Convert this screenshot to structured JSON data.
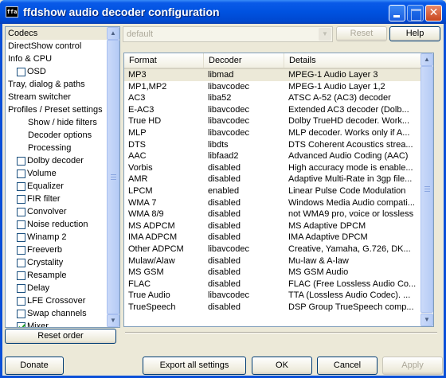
{
  "window": {
    "title": "ffdshow audio decoder configuration",
    "icon_label": "ffa"
  },
  "sidebar": {
    "items": [
      {
        "label": "Codecs",
        "type": "plain",
        "selected": true
      },
      {
        "label": "DirectShow control",
        "type": "plain"
      },
      {
        "label": "Info & CPU",
        "type": "plain"
      },
      {
        "label": "OSD",
        "type": "check",
        "checked": false
      },
      {
        "label": "Tray, dialog & paths",
        "type": "plain"
      },
      {
        "label": "Stream switcher",
        "type": "plain"
      },
      {
        "label": "Profiles / Preset settings",
        "type": "plain"
      },
      {
        "label": "Show / hide filters",
        "type": "indent"
      },
      {
        "label": "Decoder options",
        "type": "indent"
      },
      {
        "label": "Processing",
        "type": "indent"
      },
      {
        "label": "Dolby decoder",
        "type": "check",
        "checked": false
      },
      {
        "label": "Volume",
        "type": "check",
        "checked": false
      },
      {
        "label": "Equalizer",
        "type": "check",
        "checked": false
      },
      {
        "label": "FIR filter",
        "type": "check",
        "checked": false
      },
      {
        "label": "Convolver",
        "type": "check",
        "checked": false
      },
      {
        "label": "Noise reduction",
        "type": "check",
        "checked": false
      },
      {
        "label": "Winamp 2",
        "type": "check",
        "checked": false
      },
      {
        "label": "Freeverb",
        "type": "check",
        "checked": false
      },
      {
        "label": "Crystality",
        "type": "check",
        "checked": false
      },
      {
        "label": "Resample",
        "type": "check",
        "checked": false
      },
      {
        "label": "Delay",
        "type": "check",
        "checked": false
      },
      {
        "label": "LFE Crossover",
        "type": "check",
        "checked": false
      },
      {
        "label": "Swap channels",
        "type": "check",
        "checked": false
      },
      {
        "label": "Mixer",
        "type": "check",
        "checked": true
      }
    ],
    "reset_order_label": "Reset order"
  },
  "preset": {
    "value": "default",
    "reset_label": "Reset",
    "help_label": "Help"
  },
  "codec_list": {
    "columns": [
      "Format",
      "Decoder",
      "Details"
    ],
    "rows": [
      [
        "MP3",
        "libmad",
        "MPEG-1 Audio Layer 3"
      ],
      [
        "MP1,MP2",
        "libavcodec",
        "MPEG-1 Audio Layer 1,2"
      ],
      [
        "AC3",
        "liba52",
        "ATSC A-52 (AC3) decoder"
      ],
      [
        "E-AC3",
        "libavcodec",
        "Extended AC3 decoder (Dolb..."
      ],
      [
        "True HD",
        "libavcodec",
        "Dolby TrueHD decoder. Work..."
      ],
      [
        "MLP",
        "libavcodec",
        "MLP decoder. Works only if A..."
      ],
      [
        "DTS",
        "libdts",
        "DTS Coherent Acoustics strea..."
      ],
      [
        "AAC",
        "libfaad2",
        "Advanced Audio Coding (AAC)"
      ],
      [
        "Vorbis",
        "disabled",
        "High accuracy mode is enable..."
      ],
      [
        "AMR",
        "disabled",
        "Adaptive Multi-Rate in 3gp file..."
      ],
      [
        "LPCM",
        "enabled",
        "Linear Pulse Code Modulation"
      ],
      [
        "WMA 7",
        "disabled",
        "Windows Media Audio compati..."
      ],
      [
        "WMA 8/9",
        "disabled",
        "not WMA9 pro, voice or lossless"
      ],
      [
        "MS ADPCM",
        "disabled",
        "MS Adaptive DPCM"
      ],
      [
        "IMA ADPCM",
        "disabled",
        "IMA Adaptive DPCM"
      ],
      [
        "Other ADPCM",
        "libavcodec",
        "Creative, Yamaha, G.726, DK..."
      ],
      [
        "Mulaw/Alaw",
        "disabled",
        "Mu-law & A-law"
      ],
      [
        "MS GSM",
        "disabled",
        "MS GSM Audio"
      ],
      [
        "FLAC",
        "disabled",
        "FLAC (Free Lossless Audio Co..."
      ],
      [
        "True Audio",
        "libavcodec",
        "TTA (Lossless Audio Codec). ..."
      ],
      [
        "TrueSpeech",
        "disabled",
        "DSP Group TrueSpeech comp..."
      ]
    ],
    "selected_row": 0
  },
  "footer": {
    "donate_label": "Donate",
    "export_label": "Export all settings",
    "ok_label": "OK",
    "cancel_label": "Cancel",
    "apply_label": "Apply"
  }
}
